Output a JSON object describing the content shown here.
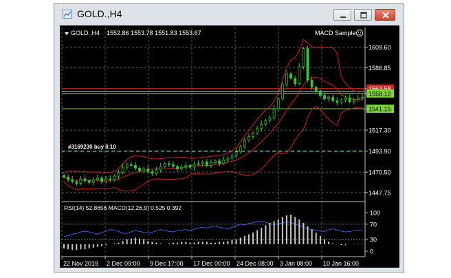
{
  "window": {
    "title": "GOLD.,H4"
  },
  "chart_header": {
    "symbol": "GOLD.,H4",
    "ohlc": "1552.86 1553.78 1551.83 1553.67",
    "expert": "MACD Sample"
  },
  "trade_label": "#3169230 buy 0.10",
  "indicator_label": "RSI(14) 52.8656  MACD(12,26,9) 0.525 0.392",
  "colors": {
    "background": "#000000",
    "grid": "#5a5a5a",
    "candles": "#3fbf3f",
    "bands": "#c0272d",
    "rsi": "#3f5fd0",
    "macd_hist": "#c8c8c8",
    "h_line_green": "#7fd23c",
    "h_line_red": "#d61f1f"
  },
  "chart_data": [
    {
      "type": "line",
      "name": "price",
      "ylim": [
        1440,
        1620
      ],
      "y_ticks": [
        "1609.60",
        "1586.85",
        "1563.58",
        "1558.12",
        "1541.15",
        "1517.30",
        "1493.90",
        "1470.50",
        "1447.75"
      ],
      "price_tags": [
        {
          "value": "1563.58",
          "color": "#d61f1f"
        },
        {
          "value": "1558.12",
          "color": "#7fd23c"
        },
        {
          "value": "1541.15",
          "color": "#7fd23c"
        }
      ],
      "x_ticks": [
        "22 Nov 2019",
        "2 Dec 09:00",
        "9 Dec 17:00",
        "17 Dec 00:00",
        "24 Dec 08:00",
        "3 Jan 08:00",
        "10 Jan 16:00"
      ],
      "close": [
        1465,
        1462,
        1460,
        1458,
        1463,
        1461,
        1459,
        1462,
        1464,
        1460,
        1463,
        1462,
        1466,
        1470,
        1476,
        1479,
        1478,
        1475,
        1472,
        1474,
        1471,
        1469,
        1473,
        1477,
        1480,
        1479,
        1477,
        1474,
        1476,
        1478,
        1476,
        1479,
        1480,
        1482,
        1478,
        1481,
        1483,
        1480,
        1484,
        1486,
        1489,
        1493,
        1499,
        1506,
        1510,
        1514,
        1519,
        1524,
        1528,
        1531,
        1541,
        1552,
        1568,
        1580,
        1575,
        1569,
        1588,
        1608,
        1573,
        1565,
        1560,
        1556,
        1552,
        1554,
        1550,
        1548,
        1551,
        1553,
        1549,
        1551,
        1553,
        1553.67
      ]
    },
    {
      "type": "line",
      "name": "RSI(14)",
      "ylim": [
        0,
        100
      ],
      "y_ticks": [
        "100",
        "70",
        "30",
        "0"
      ],
      "values": [
        38,
        40,
        44,
        46,
        50,
        52,
        50,
        47,
        44,
        48,
        52,
        56,
        55,
        51,
        47,
        46,
        50,
        54,
        51,
        49,
        47,
        49,
        53,
        56,
        54,
        51,
        50,
        53,
        55,
        56,
        54,
        57,
        60,
        62,
        60,
        63,
        65,
        62,
        60,
        58,
        62,
        66,
        70,
        68,
        72,
        74,
        76,
        78,
        75,
        72,
        69,
        71,
        73,
        76,
        74,
        70,
        66,
        62,
        58,
        56,
        54,
        52,
        51,
        55,
        58,
        55,
        52,
        50,
        51,
        53,
        54,
        52.87
      ]
    },
    {
      "type": "bar",
      "name": "MACD(12,26,9)",
      "values": [
        -5,
        -6,
        -7,
        -7,
        -6,
        -6,
        -5,
        -4,
        -3,
        -2,
        -1,
        0,
        1,
        2,
        4,
        6,
        7,
        8,
        7,
        6,
        4,
        3,
        2,
        1,
        0,
        1,
        2,
        2,
        3,
        3,
        2,
        2,
        3,
        3,
        3,
        2,
        2,
        3,
        3,
        4,
        5,
        6,
        8,
        10,
        12,
        14,
        17,
        20,
        23,
        26,
        28,
        30,
        33,
        35,
        36,
        33,
        30,
        26,
        22,
        18,
        14,
        10,
        6,
        3,
        1,
        0,
        -1,
        -1,
        0,
        0.3,
        0.4,
        0.525
      ]
    }
  ]
}
